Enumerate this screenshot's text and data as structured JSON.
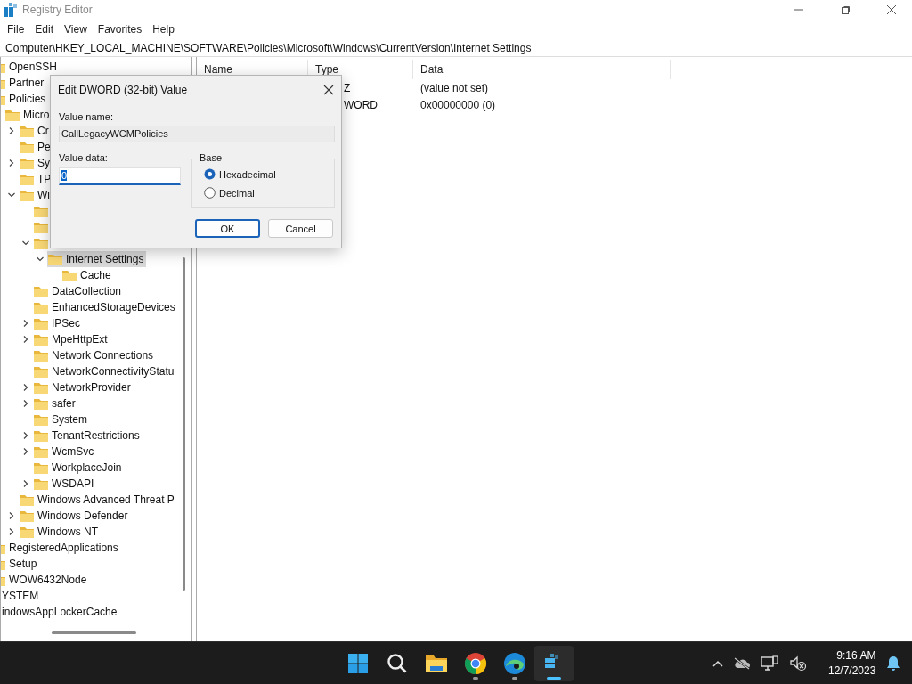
{
  "window": {
    "title": "Registry Editor"
  },
  "menu": [
    "File",
    "Edit",
    "View",
    "Favorites",
    "Help"
  ],
  "address": "Computer\\HKEY_LOCAL_MACHINE\\SOFTWARE\\Policies\\Microsoft\\Windows\\CurrentVersion\\Internet Settings",
  "tree": {
    "items": [
      {
        "label": "OpenSSH",
        "selected": false
      },
      {
        "label": "Partner",
        "selected": false
      },
      {
        "label": "Policies",
        "selected": false,
        "children": [
          {
            "label": "Micro",
            "selected": false,
            "children": [
              {
                "label": "Cr",
                "expanded": false,
                "selected": false
              },
              {
                "label": "Pe",
                "selected": false
              },
              {
                "label": "Sy",
                "expanded": false,
                "selected": false
              },
              {
                "label": "TP",
                "selected": false
              },
              {
                "label": "Wi",
                "expanded": true,
                "selected": false,
                "children": [
                  {
                    "selected": false
                  },
                  {
                    "selected": false
                  },
                  {
                    "expanded": true,
                    "selected": false,
                    "children": [
                      {
                        "label": "Internet Settings",
                        "expanded": true,
                        "selected": true,
                        "children": [
                          {
                            "label": "Cache",
                            "selected": false
                          }
                        ]
                      }
                    ]
                  },
                  {
                    "label": "DataCollection",
                    "selected": false
                  },
                  {
                    "label": "EnhancedStorageDevices",
                    "selected": false
                  },
                  {
                    "label": "IPSec",
                    "expanded": false,
                    "selected": false
                  },
                  {
                    "label": "MpeHttpExt",
                    "expanded": false,
                    "selected": false
                  },
                  {
                    "label": "Network Connections",
                    "selected": false
                  },
                  {
                    "label": "NetworkConnectivityStatu",
                    "selected": false
                  },
                  {
                    "label": "NetworkProvider",
                    "expanded": false,
                    "selected": false
                  },
                  {
                    "label": "safer",
                    "expanded": false,
                    "selected": false
                  },
                  {
                    "label": "System",
                    "selected": false
                  },
                  {
                    "label": "TenantRestrictions",
                    "expanded": false,
                    "selected": false
                  },
                  {
                    "label": "WcmSvc",
                    "expanded": false,
                    "selected": false
                  },
                  {
                    "label": "WorkplaceJoin",
                    "selected": false
                  },
                  {
                    "label": "WSDAPI",
                    "expanded": false,
                    "selected": false
                  }
                ]
              },
              {
                "label": "Windows Advanced Threat P",
                "selected": false
              },
              {
                "label": "Windows Defender",
                "expanded": false,
                "selected": false
              },
              {
                "label": "Windows NT",
                "expanded": false,
                "selected": false
              }
            ]
          }
        ]
      },
      {
        "label": "RegisteredApplications",
        "selected": false
      },
      {
        "label": "Setup",
        "selected": false
      },
      {
        "label": "WOW6432Node",
        "selected": false
      }
    ],
    "outer_items": [
      {
        "label": "YSTEM",
        "selected": false
      },
      {
        "label": "indowsAppLockerCache",
        "selected": false
      }
    ]
  },
  "list": {
    "columns": [
      "Name",
      "Type",
      "Data"
    ],
    "rows": [
      {
        "type": "Z",
        "data": "(value not set)"
      },
      {
        "type": "WORD",
        "data": "0x00000000 (0)"
      }
    ]
  },
  "dialog": {
    "title": "Edit DWORD (32-bit) Value",
    "name_label": "Value name:",
    "name_value": "CallLegacyWCMPolicies",
    "data_label": "Value data:",
    "data_value": "0",
    "base_label": "Base",
    "bases": [
      {
        "label": "Hexadecimal",
        "selected": true
      },
      {
        "label": "Decimal",
        "selected": false
      }
    ],
    "buttons": [
      {
        "label": "OK",
        "default": true
      },
      {
        "label": "Cancel",
        "default": false
      }
    ]
  },
  "taskbar": {
    "apps": [
      {
        "kind": "start",
        "running": false,
        "active": false
      },
      {
        "kind": "search",
        "running": false,
        "active": false
      },
      {
        "kind": "folder",
        "running": false,
        "active": false
      },
      {
        "kind": "ring-browser",
        "running": true,
        "active": false
      },
      {
        "kind": "wave-browser",
        "running": true,
        "active": false
      },
      {
        "kind": "cubes",
        "running": true,
        "active": true
      }
    ],
    "tray": [
      {
        "kind": "chevron"
      },
      {
        "kind": "cloud-off"
      },
      {
        "kind": "network"
      },
      {
        "kind": "volume-off"
      }
    ],
    "time": "9:16 AM",
    "date": "12/7/2023"
  }
}
